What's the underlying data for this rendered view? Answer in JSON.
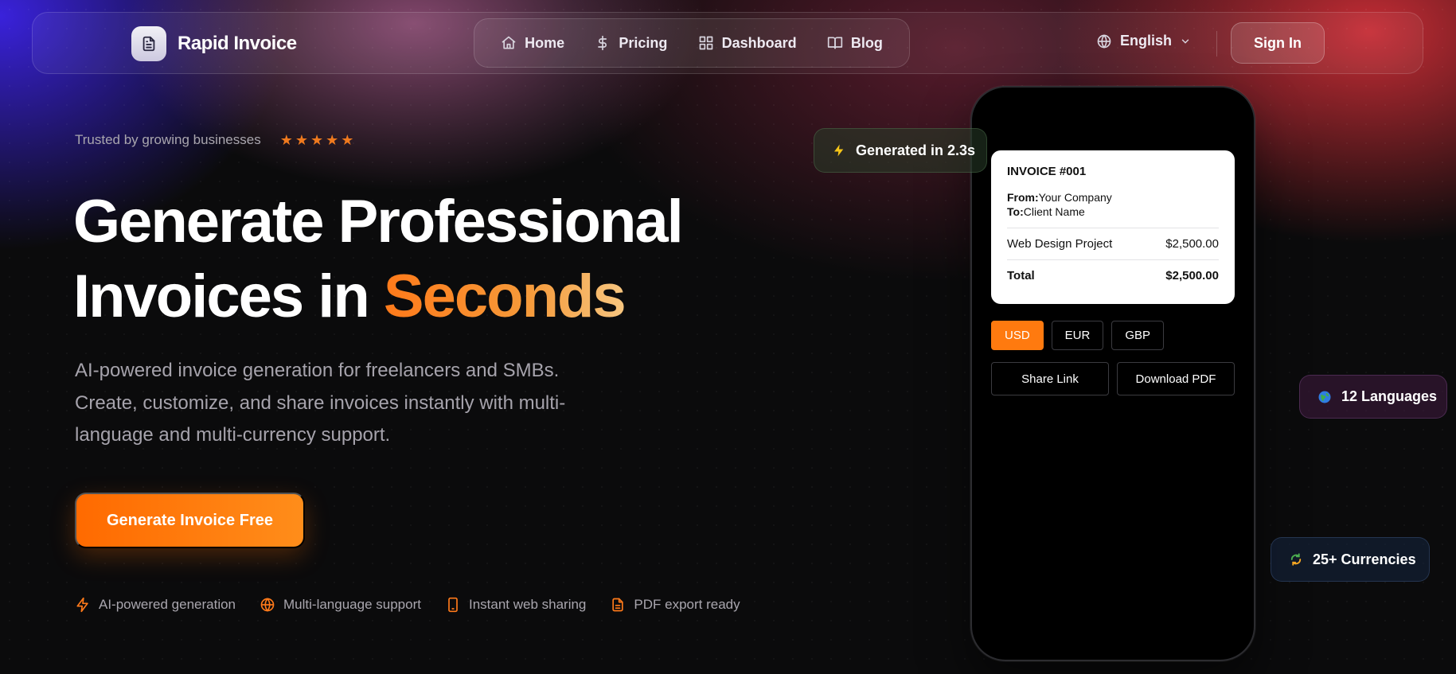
{
  "brand": {
    "name": "Rapid Invoice",
    "icon": "document-icon"
  },
  "nav": {
    "links": [
      {
        "label": "Home",
        "icon": "home-icon"
      },
      {
        "label": "Pricing",
        "icon": "dollar-icon"
      },
      {
        "label": "Dashboard",
        "icon": "dashboard-icon"
      },
      {
        "label": "Blog",
        "icon": "book-icon"
      }
    ],
    "language": "English",
    "signin_label": "Sign In"
  },
  "hero": {
    "trusted_text": "Trusted by growing businesses",
    "rating_stars": 5,
    "headline_line1": "Generate Professional",
    "headline_line2_plain": "Invoices in ",
    "headline_line2_accent": "Seconds",
    "subtitle": "AI-powered invoice generation for freelancers and SMBs. Create, customize, and share invoices instantly with multi-language and multi-currency support.",
    "cta_label": "Generate Invoice Free",
    "features": [
      {
        "label": "AI-powered generation",
        "icon": "bolt-icon"
      },
      {
        "label": "Multi-language support",
        "icon": "globe-icon"
      },
      {
        "label": "Instant web sharing",
        "icon": "phone-icon"
      },
      {
        "label": "PDF export ready",
        "icon": "file-icon"
      }
    ]
  },
  "invoice": {
    "title": "INVOICE #001",
    "from_label": "From:",
    "from_value": "Your Company",
    "to_label": "To:",
    "to_value": "Client Name",
    "line_item": "Web Design Project",
    "line_amount": "$2,500.00",
    "total_label": "Total",
    "total_amount": "$2,500.00",
    "currencies": [
      "USD",
      "EUR",
      "GBP"
    ],
    "selected_currency": "USD",
    "share_label": "Share Link",
    "download_label": "Download PDF"
  },
  "badges": {
    "generated": "Generated in 2.3s",
    "languages": "12 Languages",
    "currencies": "25+ Currencies"
  },
  "colors": {
    "accent": "#ff7a0f",
    "background": "#0b0b0c",
    "star": "#ef7a1e"
  }
}
